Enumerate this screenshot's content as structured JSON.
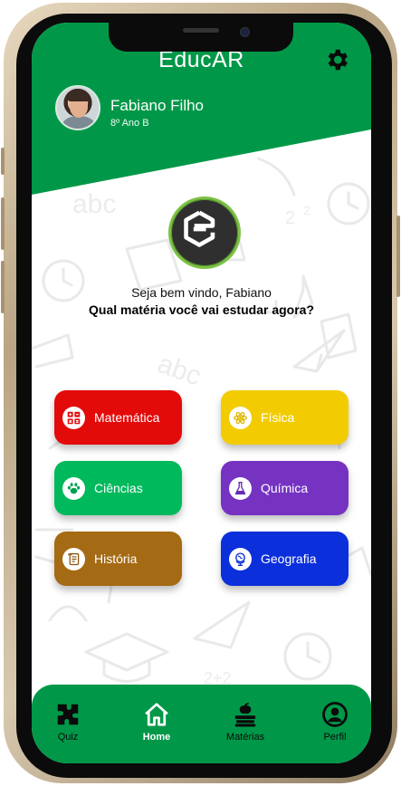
{
  "app": {
    "title": "EducAR"
  },
  "user": {
    "name": "Fabiano Filho",
    "class": "8º Ano B"
  },
  "welcome": {
    "greeting": "Seja bem vindo, Fabiano",
    "question": "Qual matéria você vai estudar agora?"
  },
  "subjects": [
    {
      "label": "Matemática",
      "icon": "math-icon",
      "color": "#e00000"
    },
    {
      "label": "Física",
      "icon": "atom-icon",
      "color": "#f2c800"
    },
    {
      "label": "Ciências",
      "icon": "paw-icon",
      "color": "#00b85c"
    },
    {
      "label": "Química",
      "icon": "flask-icon",
      "color": "#7a33c4"
    },
    {
      "label": "História",
      "icon": "scroll-icon",
      "color": "#a86b12"
    },
    {
      "label": "Geografia",
      "icon": "globe-icon",
      "color": "#0a2fd9"
    }
  ],
  "nav": [
    {
      "label": "Quiz",
      "icon": "puzzle-icon"
    },
    {
      "label": "Home",
      "icon": "home-icon",
      "active": true
    },
    {
      "label": "Matérias",
      "icon": "books-icon"
    },
    {
      "label": "Perfil",
      "icon": "profile-icon"
    }
  ],
  "colors": {
    "primary": "#009848",
    "background": "#ffffff"
  }
}
